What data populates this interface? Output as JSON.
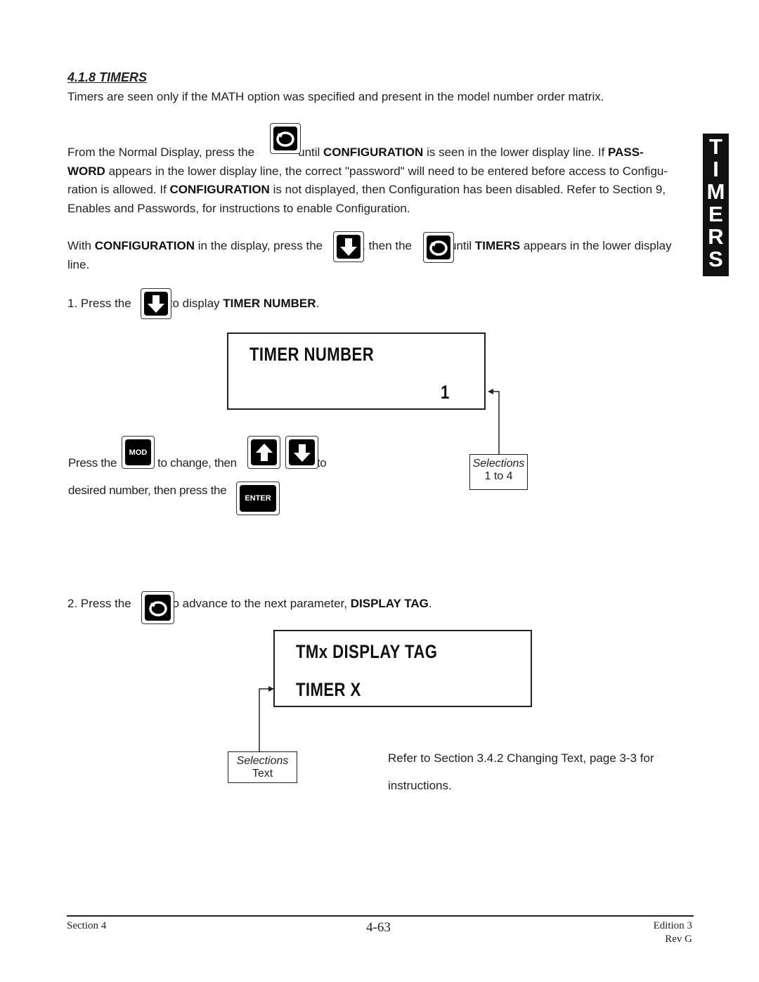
{
  "heading": "4.1.8 TIMERS",
  "intro": "Timers are seen only if the MATH option was specified and present in the model number order matrix.",
  "p1": {
    "a": "From the Normal Display, press the",
    "b": "until",
    "c": "CONFIGURATION",
    "d": "is seen in the lower display line.  If",
    "e": "PASS-",
    "f": "WORD",
    "g": "appears in the lower display line, the correct \"password\" will need to be entered before access to Configu-",
    "h": "ration is allowed.  If",
    "i": "CONFIGURATION",
    "j": "is not displayed, then Configuration has been disabled.  Refer to Section 9,",
    "k": "Enables and Passwords, for instructions to enable Configuration."
  },
  "p2": {
    "a": "With",
    "b": "CONFIGURATION",
    "c": "in the display, press the",
    ",d": "",
    "d": ", then the",
    "e": "until",
    "f": "TIMERS",
    "g": "appears in the lower display",
    "h": "line."
  },
  "step1": {
    "a": "1.  Press the",
    "b": "to display",
    "c": "TIMER NUMBER",
    "d": "."
  },
  "lcd1": {
    "line1": "TIMER  NUMBER",
    "value": "1"
  },
  "sel1": {
    "label": "Selections",
    "value": "1 to 4"
  },
  "instr": {
    "a": "Press the",
    "b": "to change, then",
    "c": "to",
    "d": "desired number, then press the",
    "e": "."
  },
  "step2": {
    "a": "2.  Press  the",
    "b": "to advance to the next parameter,",
    "c": "DISPLAY TAG",
    "d": "."
  },
  "lcd2": {
    "line1": "TMx  DISPLAY  TAG",
    "line2": "TIMER  X"
  },
  "sel2": {
    "label": "Selections",
    "value": "Text"
  },
  "refer": {
    "a": "Refer to Section 3.4.2 Changing Text, page 3-3 for",
    "b": "instructions."
  },
  "side_tab": [
    "T",
    "I",
    "M",
    "E",
    "R",
    "S"
  ],
  "keys": {
    "mod": "MOD",
    "enter": "ENTER",
    "icons": [
      "scroll-icon",
      "down-arrow-icon",
      "up-arrow-icon"
    ]
  },
  "footer": {
    "left": "Section 4",
    "center": "4-63",
    "right1": "Edition 3",
    "right2": "Rev G"
  }
}
